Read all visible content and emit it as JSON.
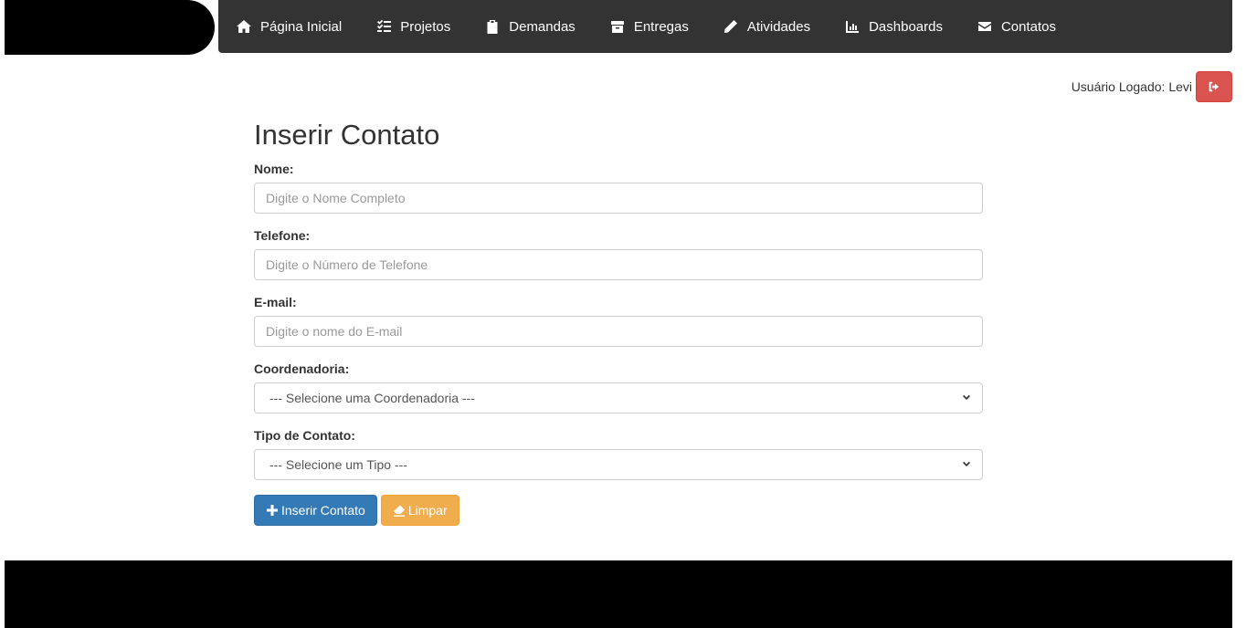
{
  "nav": {
    "items": [
      {
        "label": "Página Inicial",
        "icon": "home-icon"
      },
      {
        "label": "Projetos",
        "icon": "tasks-icon"
      },
      {
        "label": "Demandas",
        "icon": "clipboard-icon"
      },
      {
        "label": "Entregas",
        "icon": "box-icon"
      },
      {
        "label": "Atividades",
        "icon": "pencil-icon"
      },
      {
        "label": "Dashboards",
        "icon": "chart-icon"
      },
      {
        "label": "Contatos",
        "icon": "envelope-icon"
      }
    ]
  },
  "user": {
    "label": "Usuário Logado: Levi",
    "logout_icon": "sign-out-icon"
  },
  "form": {
    "title": "Inserir Contato",
    "name_label": "Nome:",
    "name_placeholder": "Digite o Nome Completo",
    "phone_label": "Telefone:",
    "phone_placeholder": "Digite o Número de Telefone",
    "email_label": "E-mail:",
    "email_placeholder": "Digite o nome do E-mail",
    "coord_label": "Coordenadoria:",
    "coord_selected": "--- Selecione uma Coordenadoria ---",
    "type_label": "Tipo de Contato:",
    "type_selected": "--- Selecione um Tipo ---",
    "submit_label": "Inserir Contato",
    "clear_label": "Limpar"
  },
  "colors": {
    "navbar": "#333333",
    "primary": "#337ab7",
    "warning": "#f0ad4e",
    "danger": "#d9534f"
  }
}
